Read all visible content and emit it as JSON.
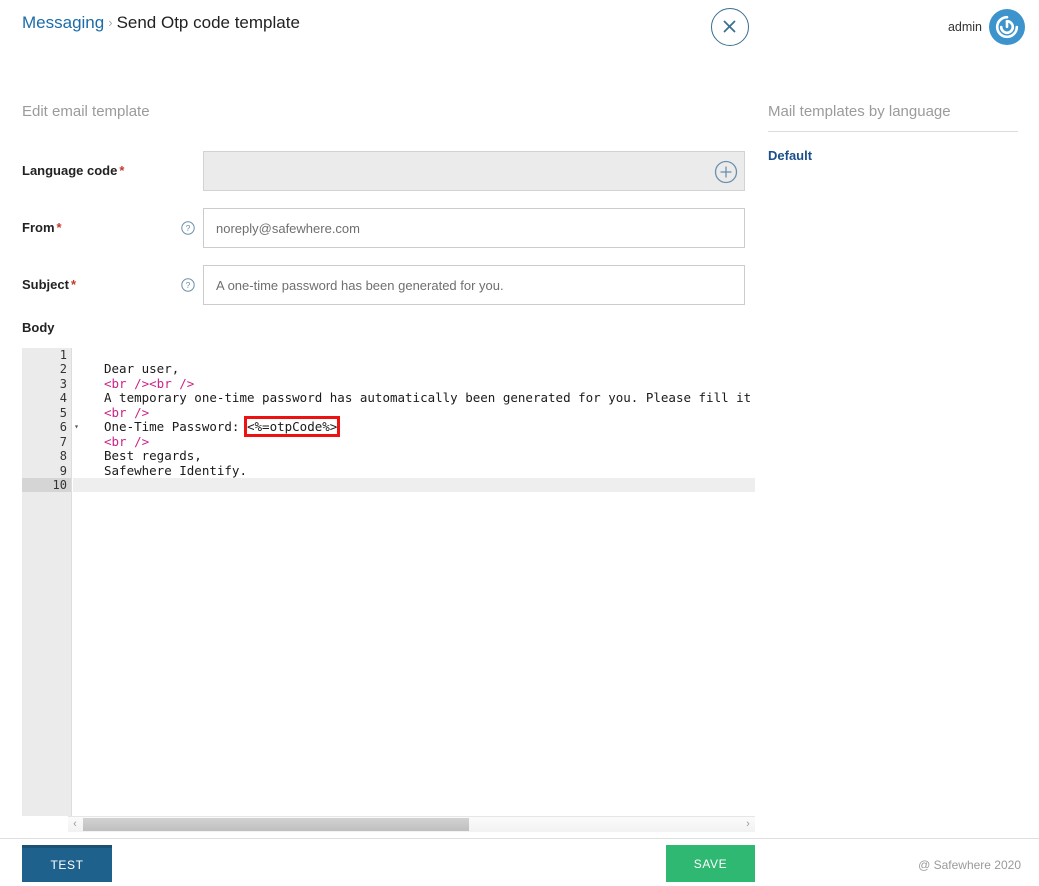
{
  "header": {
    "breadcrumb_root": "Messaging",
    "breadcrumb_separator": "›",
    "breadcrumb_current": "Send Otp code template",
    "close_icon": "close-circle-icon",
    "user_name": "admin",
    "avatar_icon": "safewhere-spiral-logo-icon"
  },
  "form": {
    "section_title": "Edit email template",
    "required_marker": "*",
    "help_icon": "question-mark-circle-icon",
    "add_icon": "plus-circle-icon",
    "fields": {
      "language_code": {
        "label": "Language code",
        "value": "",
        "placeholder": "",
        "disabled": true
      },
      "from": {
        "label": "From",
        "value": "noreply@safewhere.com",
        "placeholder": ""
      },
      "subject": {
        "label": "Subject",
        "value": "A one-time password has been generated for you.",
        "placeholder": ""
      }
    },
    "body_label": "Body"
  },
  "editor": {
    "line_numbers": [
      "1",
      "2",
      "3",
      "4",
      "5",
      "6",
      "7",
      "8",
      "9",
      "10"
    ],
    "active_line": "10",
    "fold_line": "6",
    "fold_icon": "chevron-down-fold-icon",
    "lines": [
      {
        "n": "1",
        "parts": []
      },
      {
        "n": "2",
        "parts": [
          {
            "t": "Dear user,",
            "k": "text"
          }
        ]
      },
      {
        "n": "3",
        "parts": [
          {
            "t": "<br /><br />",
            "k": "tag"
          }
        ]
      },
      {
        "n": "4",
        "parts": [
          {
            "t": "A temporary one-time password has automatically been generated for you. Please fill it i",
            "k": "text"
          }
        ]
      },
      {
        "n": "5",
        "parts": [
          {
            "t": "<br />",
            "k": "tag"
          }
        ]
      },
      {
        "n": "6",
        "parts": [
          {
            "t": "One-Time Password: ",
            "k": "text"
          },
          {
            "t": "<%=otpCode%>",
            "k": "highlight"
          }
        ]
      },
      {
        "n": "7",
        "parts": [
          {
            "t": "<br />",
            "k": "tag"
          }
        ]
      },
      {
        "n": "8",
        "parts": [
          {
            "t": "Best regards,",
            "k": "text"
          }
        ]
      },
      {
        "n": "9",
        "parts": [
          {
            "t": "Safewhere Identify.",
            "k": "text"
          }
        ]
      },
      {
        "n": "10",
        "parts": []
      }
    ],
    "scrollbar": {
      "left_arrow": "‹",
      "right_arrow": "›"
    }
  },
  "right_panel": {
    "title": "Mail templates by language",
    "items": [
      {
        "label": "Default"
      }
    ]
  },
  "footer": {
    "test_label": "TEST",
    "save_label": "SAVE",
    "copyright": "@ Safewhere 2020"
  },
  "colors": {
    "link_blue": "#1b6ca8",
    "accent_blue": "#3b6f92",
    "avatar_blue": "#3d93cc",
    "required_red": "#c0392b",
    "highlight_red": "#ee1111",
    "test_button": "#1f618d",
    "save_button": "#2eb872",
    "tag_pink": "#cc2288",
    "muted_gray": "#9b9b9b"
  }
}
